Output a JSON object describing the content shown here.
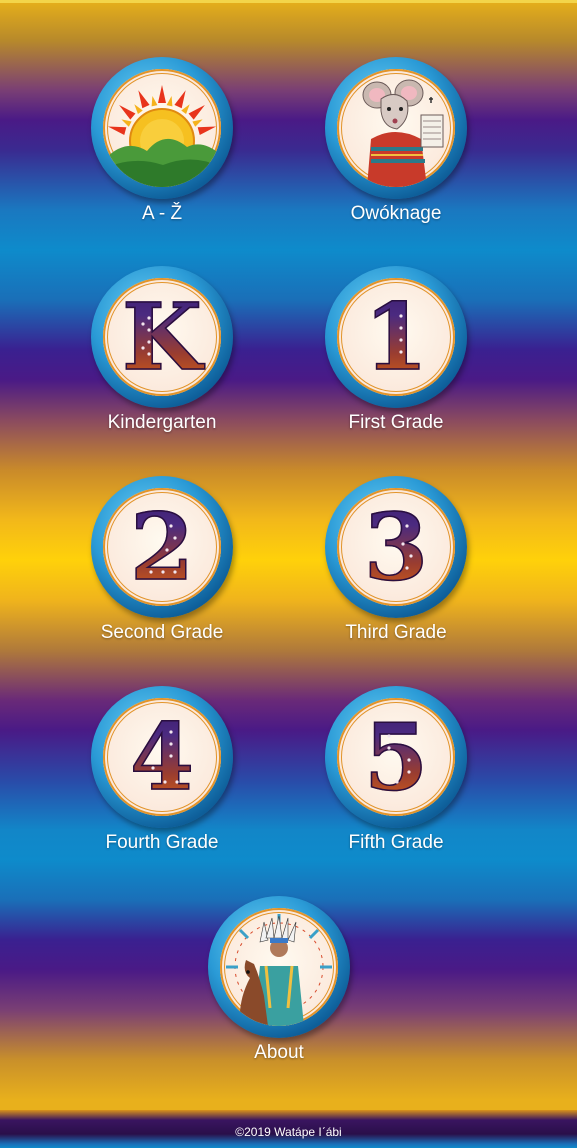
{
  "tiles": [
    {
      "label": "A - Ž",
      "icon": "sunrise-icon"
    },
    {
      "label": "Owóknage",
      "icon": "mouse-storyteller-icon"
    },
    {
      "label": "Kindergarten",
      "icon": "letter-k-icon",
      "glyph": "K"
    },
    {
      "label": "First Grade",
      "icon": "number-1-icon",
      "glyph": "1"
    },
    {
      "label": "Second Grade",
      "icon": "number-2-icon",
      "glyph": "2"
    },
    {
      "label": "Third Grade",
      "icon": "number-3-icon",
      "glyph": "3"
    },
    {
      "label": "Fourth Grade",
      "icon": "number-4-icon",
      "glyph": "4"
    },
    {
      "label": "Fifth Grade",
      "icon": "number-5-icon",
      "glyph": "5"
    },
    {
      "label": "About",
      "icon": "chief-on-horse-icon"
    }
  ],
  "footer": {
    "copyright": "©2019 Watápe Iˊábi"
  },
  "colors": {
    "ring": "#1f8fd0",
    "glyph_top": "#3a1c6e",
    "glyph_bottom": "#e06612",
    "label": "#ffffff"
  }
}
